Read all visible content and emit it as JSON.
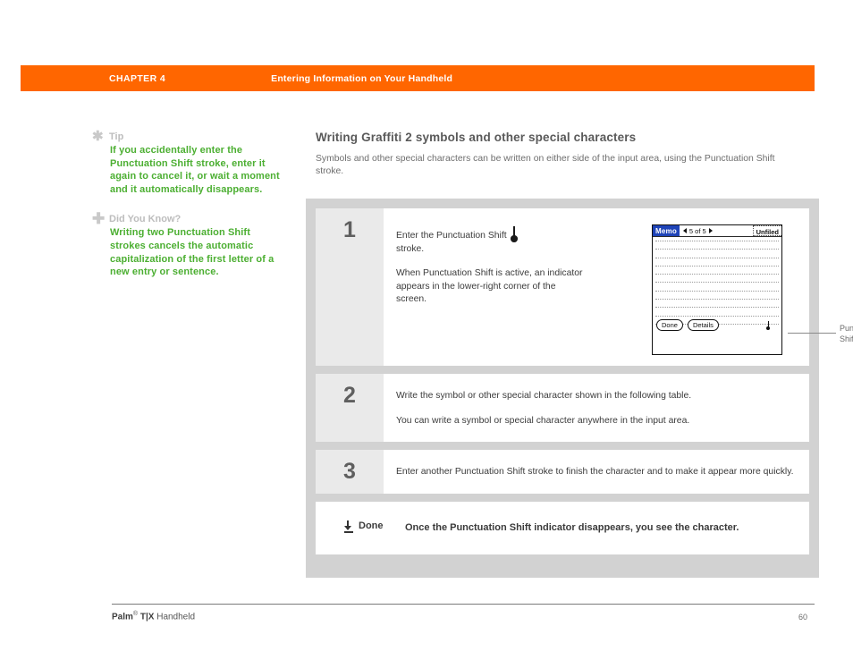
{
  "header": {
    "chapter_label": "CHAPTER 4",
    "chapter_title": "Entering Information on Your Handheld",
    "accent_color": "#FF6600"
  },
  "sidebar": {
    "notes": [
      {
        "icon": "asterisk-icon",
        "icon_glyph": "✱",
        "title": "Tip",
        "body": "If you accidentally enter the Punctuation Shift stroke, enter it again to cancel it, or wait a moment and it automatically disappears."
      },
      {
        "icon": "plus-icon",
        "icon_glyph": "✚",
        "title": "Did You Know?",
        "body": "Writing two Punctuation Shift strokes cancels the automatic capitalization of the first letter of a new entry or sentence."
      }
    ],
    "text_color": "#4CAF32",
    "title_color": "#BDBDBD"
  },
  "main": {
    "heading": "Writing Graffiti 2 symbols and other special characters",
    "subheading": "Symbols and other special characters can be written on either side of the input area, using the Punctuation Shift stroke."
  },
  "steps": [
    {
      "number": "1",
      "paragraphs": [
        "Enter the Punctuation Shift",
        "stroke.",
        "When Punctuation Shift is active, an indicator appears in the lower-right corner of the screen."
      ],
      "line1": "Enter the Punctuation Shift",
      "line2": "stroke.",
      "para2": "When Punctuation Shift is active, an indicator appears in the lower-right corner of the screen."
    },
    {
      "number": "2",
      "paragraphs": [
        "Write the symbol or other special character shown in the following table.",
        "You can write a symbol or special character anywhere in the input area."
      ]
    },
    {
      "number": "3",
      "paragraphs": [
        "Enter another Punctuation Shift stroke to finish the character and to make it appear more quickly."
      ]
    }
  ],
  "done": {
    "icon": "download-arrow-icon",
    "label": "Done",
    "text": "Once the Punctuation Shift indicator disappears, you see the character."
  },
  "device": {
    "app_name": "Memo",
    "record_counter": "5 of 5",
    "category": "Unfiled",
    "prev_icon": "triangle-left-icon",
    "next_icon": "triangle-right-icon",
    "buttons": [
      {
        "label": "Done"
      },
      {
        "label": "Details"
      }
    ],
    "indicator_icon": "punctuation-shift-indicator-icon",
    "titlebar_color": "#1F44B8"
  },
  "callout": {
    "line1": "Punctuation",
    "line2": "Shift indicator"
  },
  "footer": {
    "product_bold": "Palm",
    "product_reg": "®",
    "product_model": " T|X",
    "product_suffix": " Handheld",
    "page_number": "60"
  }
}
